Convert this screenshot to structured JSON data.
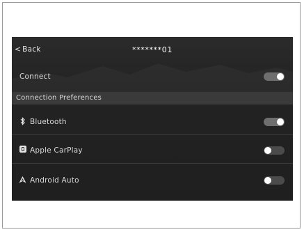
{
  "header": {
    "back_label": "Back",
    "back_chevron": "<",
    "title": "*******01"
  },
  "connect": {
    "label": "Connect",
    "state": "on"
  },
  "section": {
    "title": "Connection Preferences"
  },
  "preferences": [
    {
      "label": "Bluetooth",
      "icon": "bluetooth-icon",
      "state": "on"
    },
    {
      "label": "Apple CarPlay",
      "icon": "carplay-icon",
      "state": "off"
    },
    {
      "label": "Android Auto",
      "icon": "android-auto-icon",
      "state": "off"
    }
  ],
  "colors": {
    "toggle_on": "#6e6e6e",
    "toggle_off": "#4b4b4b",
    "knob": "#ffffff",
    "screen_bg": "#232323",
    "section_bg": "#3a3a3a"
  }
}
